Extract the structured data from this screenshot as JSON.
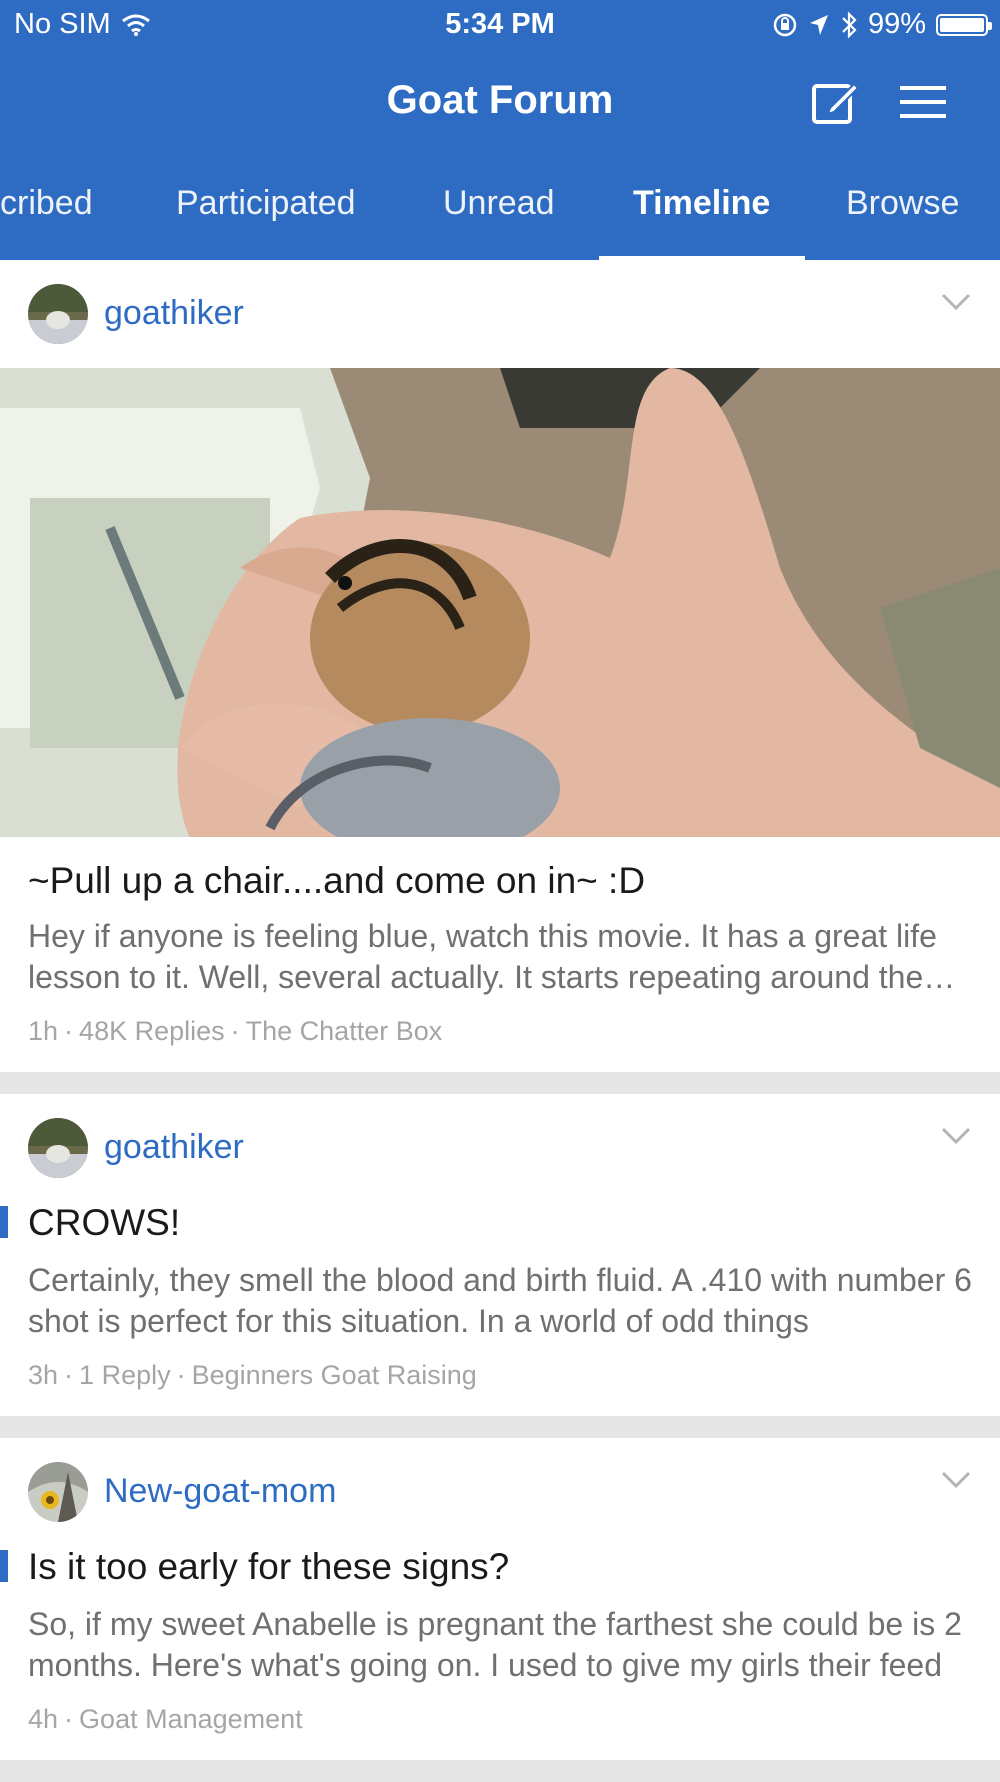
{
  "status_bar": {
    "carrier": "No SIM",
    "time": "5:34 PM",
    "battery": "99%",
    "battery_level": 0.99
  },
  "header": {
    "title": "Goat Forum",
    "compose_icon": "compose-icon",
    "menu_icon": "hamburger-menu-icon"
  },
  "tabs": [
    {
      "label": "cribed",
      "active": false
    },
    {
      "label": "Participated",
      "active": false
    },
    {
      "label": "Unread",
      "active": false
    },
    {
      "label": "Timeline",
      "active": true
    },
    {
      "label": "Browse",
      "active": false
    }
  ],
  "posts": [
    {
      "username": "goathiker",
      "title": "~Pull up a chair....and come on in~ :D",
      "excerpt": "Hey if anyone is feeling blue, watch this movie. It has a great life lesson to it. Well, several actually. It starts repeating around the middle",
      "time": "1h",
      "replies": "48K Replies",
      "forum": "The Chatter Box",
      "has_image": true,
      "unread": false
    },
    {
      "username": "goathiker",
      "title": "CROWS!",
      "excerpt": "Certainly, they smell the blood and birth fluid.  A .410 with number 6 shot is perfect for this situation.   In a world of odd things",
      "time": "3h",
      "replies": "1 Reply",
      "forum": "Beginners Goat Raising",
      "has_image": false,
      "unread": true
    },
    {
      "username": "New-goat-mom",
      "title": "Is it too early for these signs?",
      "excerpt": "So, if my sweet Anabelle is pregnant the farthest she could be is 2 months. Here's what's going on. I used to give my girls their feed",
      "time": "4h",
      "forum": "Goat Management",
      "has_image": false,
      "unread": true
    }
  ],
  "colors": {
    "brand": "#2e6cc3",
    "separator": "#e6e6e6",
    "meta_text": "#a5a5a5"
  }
}
